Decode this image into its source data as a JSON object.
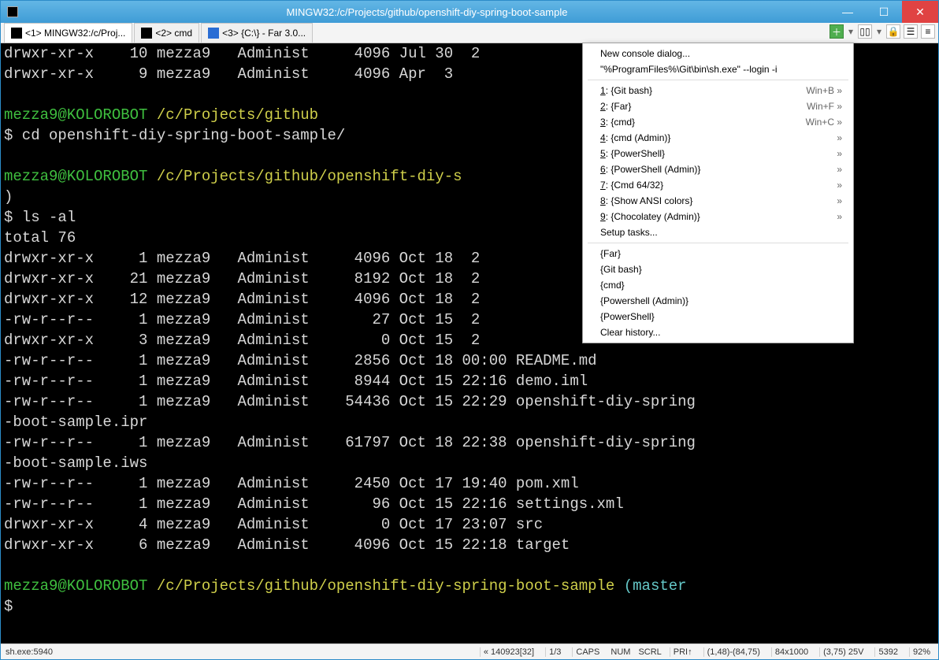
{
  "window": {
    "title": "MINGW32:/c/Projects/github/openshift-diy-spring-boot-sample"
  },
  "tabs": [
    {
      "label": "<1> MINGW32:/c/Proj...",
      "active": true,
      "iconClass": "black"
    },
    {
      "label": "<2> cmd",
      "active": false,
      "iconClass": "black"
    },
    {
      "label": "<3> {C:\\} - Far 3.0...",
      "active": false,
      "iconClass": "blue"
    }
  ],
  "terminal": {
    "top_lines": [
      "drwxr-xr-x    10 mezza9   Administ     4096 Jul 30  2",
      "drwxr-xr-x     9 mezza9   Administ     4096 Apr  3"
    ],
    "prompt1": {
      "user": "mezza9@KOLOROBOT",
      "path": " /c/Projects/github"
    },
    "cmd1": "$ cd openshift-diy-spring-boot-sample/",
    "prompt2": {
      "user": "mezza9@KOLOROBOT",
      "path": " /c/Projects/github/openshift-diy-s"
    },
    "paren1": ")",
    "cmd2": "$ ls -al",
    "total": "total 76",
    "rows": [
      "drwxr-xr-x     1 mezza9   Administ     4096 Oct 18  2",
      "drwxr-xr-x    21 mezza9   Administ     8192 Oct 18  2",
      "drwxr-xr-x    12 mezza9   Administ     4096 Oct 18  2",
      "-rw-r--r--     1 mezza9   Administ       27 Oct 15  2",
      "drwxr-xr-x     3 mezza9   Administ        0 Oct 15  2"
    ],
    "rows_rest": [
      "-rw-r--r--     1 mezza9   Administ     2856 Oct 18 00:00 README.md",
      "-rw-r--r--     1 mezza9   Administ     8944 Oct 15 22:16 demo.iml",
      "-rw-r--r--     1 mezza9   Administ    54436 Oct 15 22:29 openshift-diy-spring",
      "-boot-sample.ipr",
      "-rw-r--r--     1 mezza9   Administ    61797 Oct 18 22:38 openshift-diy-spring",
      "-boot-sample.iws",
      "-rw-r--r--     1 mezza9   Administ     2450 Oct 17 19:40 pom.xml",
      "-rw-r--r--     1 mezza9   Administ       96 Oct 15 22:16 settings.xml",
      "drwxr-xr-x     4 mezza9   Administ        0 Oct 17 23:07 src",
      "drwxr-xr-x     6 mezza9   Administ     4096 Oct 15 22:18 target"
    ],
    "prompt3": {
      "user": "mezza9@KOLOROBOT",
      "path": " /c/Projects/github/openshift-diy-spring-boot-sample ",
      "branch": "(master"
    },
    "dollar": "$"
  },
  "menu": {
    "top": [
      {
        "label": "New console dialog..."
      },
      {
        "label": "\"%ProgramFiles%\\Git\\bin\\sh.exe\" --login -i"
      }
    ],
    "tasks": [
      {
        "key": "1",
        "name": "{Git bash}",
        "shortcut": "Win+B »"
      },
      {
        "key": "2",
        "name": "{Far}",
        "shortcut": "Win+F »"
      },
      {
        "key": "3",
        "name": "{cmd}",
        "shortcut": "Win+C »"
      },
      {
        "key": "4",
        "name": "{cmd (Admin)}",
        "shortcut": "»"
      },
      {
        "key": "5",
        "name": "{PowerShell}",
        "shortcut": "»"
      },
      {
        "key": "6",
        "name": "{PowerShell (Admin)}",
        "shortcut": "»"
      },
      {
        "key": "7",
        "name": "{Cmd 64/32}",
        "shortcut": "»"
      },
      {
        "key": "8",
        "name": "{Show ANSI colors}",
        "shortcut": "»"
      },
      {
        "key": "9",
        "name": "{Chocolatey (Admin)}",
        "shortcut": "»"
      }
    ],
    "setup": "Setup tasks...",
    "history": [
      "{Far}",
      "{Git bash}",
      "{cmd}",
      "{Powershell (Admin)}",
      "{PowerShell}"
    ],
    "clear": "Clear history..."
  },
  "status": {
    "left": "sh.exe:5940",
    "seg1": "« 140923[32]",
    "seg2": "1/3",
    "caps": "CAPS",
    "num": "NUM",
    "scrl": "SCRL",
    "pri": "PRI↑",
    "pos": "(1,48)-(84,75)",
    "size": "84x1000",
    "cur": "(3,75) 25V",
    "mem": "5392",
    "pct": "92%"
  }
}
